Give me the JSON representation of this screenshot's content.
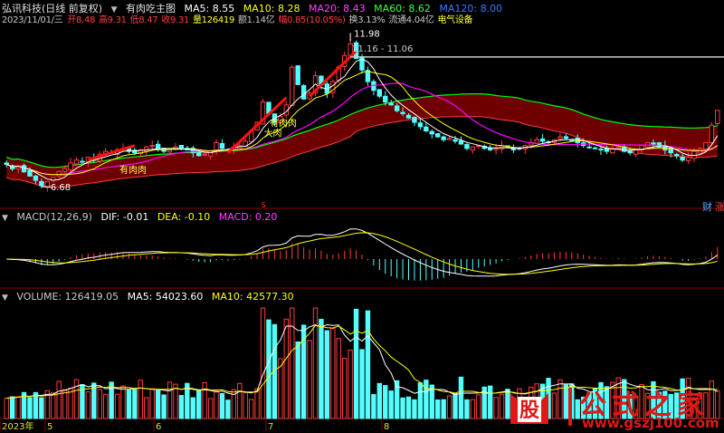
{
  "header": {
    "stock_name": "弘讯科技(日线 前复权)",
    "indicator_name": "有肉吃主图",
    "ma5_label": "MA5: 8.55",
    "ma10_label": "MA10: 8.28",
    "ma20_label": "MA20: 8.43",
    "ma60_label": "MA60: 8.62",
    "ma120_label": "MA120: 8.00"
  },
  "quote": {
    "date": "2023/11/01/三",
    "open": "开8.48",
    "high": "高9.31",
    "low": "低8.47",
    "close": "收9.31",
    "volume": "量126419",
    "amount": "额1.14亿",
    "change": "幅0.85(10.05%)",
    "turnover": "换3.13%",
    "float": "流通4.04亿",
    "sector": "电气设备"
  },
  "annotations": {
    "high_price": "11.98",
    "range": "11.16 - 11.06",
    "low_price": "6.68",
    "signal_1": "有肉肉",
    "signal_2": "有肉肉",
    "signal_3": "大肉",
    "marker_s": "S"
  },
  "macd": {
    "title": "MACD(12,26,9)",
    "dif": "DIF: -0.01",
    "dea": "DEA: -0.10",
    "macd": "MACD: 0.20"
  },
  "volume": {
    "title": "VOLUME: 126419.05",
    "ma5": "MA5: 54023.60",
    "ma10": "MA10: 42577.30"
  },
  "x_axis": {
    "labels": [
      "2023年",
      "5",
      "6",
      "7",
      "8"
    ]
  },
  "buttons": {
    "cai": "财",
    "zhang": "涨"
  },
  "watermark": {
    "logo": "股",
    "title": "公式之家",
    "url": "www.gszj100.com"
  },
  "colors": {
    "up": "#ff3c3c",
    "down": "#54ffff",
    "ma5": "#ffffff",
    "ma10": "#ffff00",
    "ma20": "#ff00ff",
    "ma60": "#00ff00",
    "ma120": "#3c78ff",
    "band": "#7a0000"
  },
  "chart_data": [
    {
      "type": "candlestick",
      "title": "弘讯科技(日线 前复权)",
      "y_range": [
        6.0,
        12.3
      ],
      "price_path": [
        7.45,
        7.3,
        7.4,
        7.2,
        7.05,
        6.9,
        6.72,
        6.85,
        7.0,
        7.2,
        7.3,
        7.5,
        7.6,
        7.55,
        7.7,
        7.6,
        7.8,
        7.9,
        7.85,
        7.95,
        8.0,
        7.9,
        7.85,
        7.95,
        8.05,
        8.1,
        8.0,
        7.9,
        7.95,
        8.05,
        8.0,
        7.95,
        7.85,
        7.75,
        7.8,
        7.9,
        8.2,
        8.0,
        7.95,
        8.05,
        8.1,
        8.25,
        8.6,
        8.9,
        9.6,
        9.2,
        8.9,
        9.1,
        9.5,
        10.8,
        10.2,
        9.7,
        9.9,
        10.5,
        10.2,
        9.9,
        10.3,
        10.8,
        11.2,
        11.6,
        11.1,
        10.7,
        10.3,
        10.0,
        9.8,
        9.6,
        9.5,
        9.3,
        9.2,
        9.05,
        8.9,
        8.75,
        8.6,
        8.5,
        8.4,
        8.3,
        8.35,
        8.25,
        8.15,
        8.0,
        8.05,
        8.1,
        8.0,
        7.95,
        8.0,
        8.1,
        8.05,
        7.95,
        8.0,
        8.1,
        8.2,
        8.3,
        8.25,
        8.2,
        8.3,
        8.4,
        8.35,
        8.3,
        8.2,
        8.1,
        8.05,
        8.0,
        7.95,
        7.9,
        8.0,
        8.05,
        7.9,
        7.85,
        7.95,
        8.1,
        8.2,
        8.15,
        8.05,
        7.95,
        7.85,
        7.75,
        7.6,
        7.7,
        7.9,
        8.0,
        8.2,
        8.8,
        9.31
      ],
      "annotations": {
        "high": 11.98,
        "low": 6.68
      },
      "series": [
        {
          "name": "MA5",
          "last": 8.55
        },
        {
          "name": "MA10",
          "last": 8.28
        },
        {
          "name": "MA20",
          "last": 8.43
        },
        {
          "name": "MA60",
          "last": 8.62
        },
        {
          "name": "MA120",
          "last": 8.0
        }
      ]
    },
    {
      "type": "bar",
      "title": "MACD(12,26,9)",
      "series": [
        {
          "name": "DIF",
          "last": -0.01
        },
        {
          "name": "DEA",
          "last": -0.1
        },
        {
          "name": "MACD",
          "last": 0.2
        }
      ]
    },
    {
      "type": "bar",
      "title": "VOLUME: 126419.05",
      "series": [
        {
          "name": "MA5",
          "last": 54023.6
        },
        {
          "name": "MA10",
          "last": 42577.3
        }
      ]
    }
  ]
}
